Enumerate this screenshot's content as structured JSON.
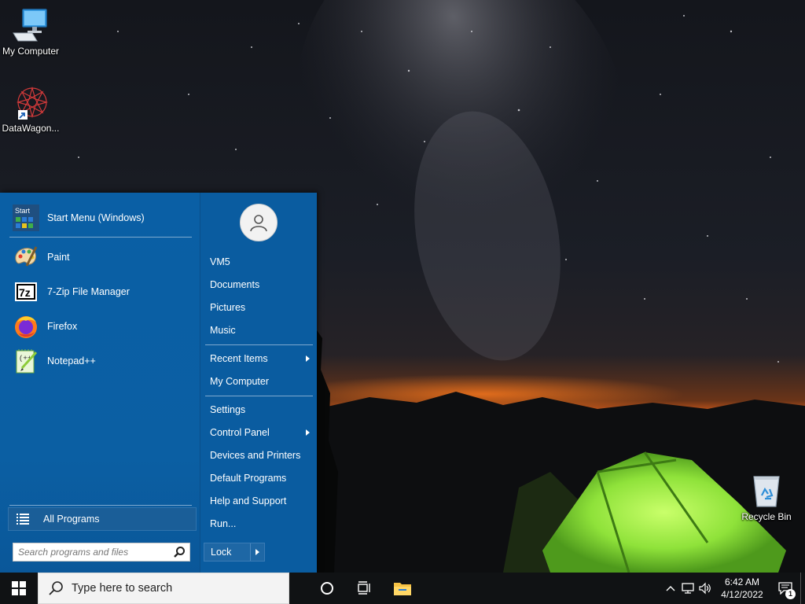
{
  "desktop": {
    "icons": [
      {
        "label": "My Computer",
        "icon": "computer-icon"
      },
      {
        "label": "DataWagon...",
        "icon": "datawagon-app-icon"
      },
      {
        "label": "Recycle Bin",
        "icon": "recycle-bin-icon"
      }
    ]
  },
  "start_menu": {
    "pinned": [
      {
        "label": "Start Menu (Windows)",
        "icon": "start-menu-settings-icon"
      },
      {
        "label": "Paint",
        "icon": "paint-palette-icon"
      },
      {
        "label": "7-Zip File Manager",
        "icon": "7zip-icon"
      },
      {
        "label": "Firefox",
        "icon": "firefox-icon"
      },
      {
        "label": "Notepad++",
        "icon": "notepad-plus-plus-icon"
      }
    ],
    "start_tile_text": "Start",
    "all_programs_label": "All Programs",
    "search_placeholder": "Search programs and files",
    "right_items": [
      {
        "label": "VM5"
      },
      {
        "label": "Documents"
      },
      {
        "label": "Pictures"
      },
      {
        "label": "Music"
      },
      {
        "label": "Recent Items",
        "submenu": true
      },
      {
        "label": "My Computer"
      },
      {
        "label": "Settings"
      },
      {
        "label": "Control Panel",
        "submenu": true
      },
      {
        "label": "Devices and Printers"
      },
      {
        "label": "Default Programs"
      },
      {
        "label": "Help and Support"
      },
      {
        "label": "Run..."
      }
    ],
    "lock_label": "Lock"
  },
  "taskbar": {
    "search_placeholder": "Type here to search",
    "time": "6:42 AM",
    "date": "4/12/2022",
    "notification_count": "1"
  },
  "colors": {
    "start_menu_bg": "#0b5ea3",
    "taskbar_bg": "#101214",
    "tent_green": "#8de03a",
    "horizon_orange": "#e0641a"
  }
}
